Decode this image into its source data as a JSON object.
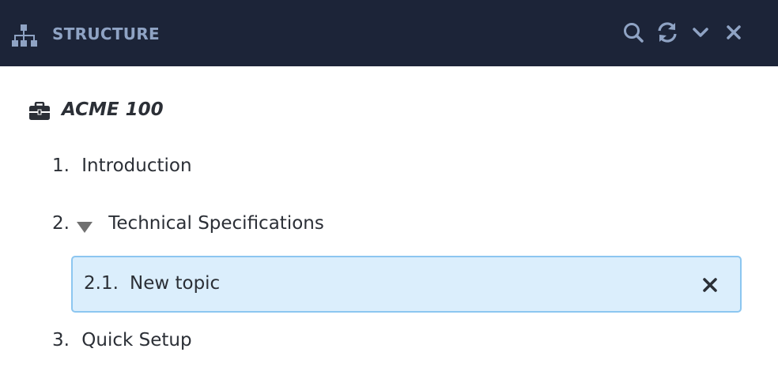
{
  "header": {
    "title": "STRUCTURE",
    "icons": [
      "sitemap-icon",
      "search-icon",
      "refresh-icon",
      "chevron-down-icon",
      "close-icon"
    ],
    "background": "#1c2438",
    "accent": "#8fa3c4"
  },
  "tree": {
    "root": {
      "icon": "briefcase-icon",
      "title": "ACME 100"
    },
    "items": [
      {
        "number": "1.",
        "label": "Introduction"
      },
      {
        "number": "2.",
        "label": "Technical Specifications",
        "expanded": true,
        "children": [
          {
            "number": "2.1.",
            "label": "New topic",
            "selected": true
          }
        ]
      },
      {
        "number": "3.",
        "label": "Quick Setup"
      }
    ]
  },
  "colors": {
    "selected_bg": "#dbeefc",
    "selected_border": "#8cc6f0"
  }
}
